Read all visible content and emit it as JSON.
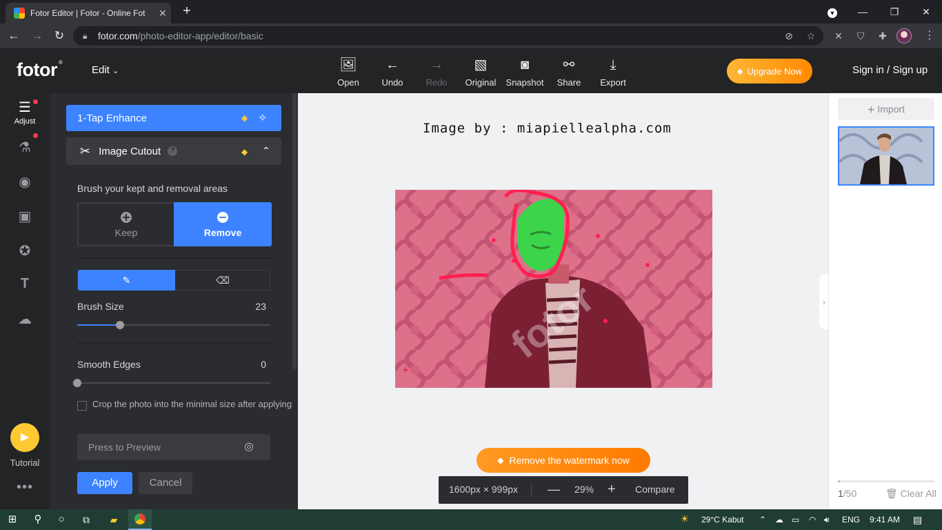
{
  "browser": {
    "tab_title": "Fotor Editor  |  Fotor - Online Fot",
    "url_host": "fotor.com",
    "url_path": "/photo-editor-app/editor/basic"
  },
  "header": {
    "logo": "fotor",
    "edit_menu": "Edit",
    "tools": [
      "Open",
      "Undo",
      "Redo",
      "Original",
      "Snapshot",
      "Share",
      "Export"
    ],
    "upgrade": "Upgrade Now",
    "sign_in": "Sign in / Sign up"
  },
  "rail": {
    "adjust": "Adjust",
    "tutorial": "Tutorial"
  },
  "panel": {
    "enhance": "1-Tap Enhance",
    "cutout": "Image Cutout",
    "brush_hint": "Brush your kept and removal areas",
    "keep": "Keep",
    "remove": "Remove",
    "brush_size_label": "Brush Size",
    "brush_size_value": "23",
    "brush_size_fraction": 0.22,
    "smooth_label": "Smooth Edges",
    "smooth_value": "0",
    "smooth_fraction": 0,
    "crop_label": "Crop the photo into the minimal size after applying",
    "crop_checked": false,
    "preview": "Press to Preview",
    "apply": "Apply",
    "cancel": "Cancel"
  },
  "canvas": {
    "credit": "Image by : miapiellealpha.com",
    "watermark_button": "Remove the watermark now",
    "dimensions": "1600px × 999px",
    "zoom": "29%",
    "compare": "Compare"
  },
  "right": {
    "import": "Import",
    "count_current": "1",
    "count_total": "/50",
    "clear_all": "Clear All"
  },
  "taskbar": {
    "weather": "29°C  Kabut",
    "lang": "ENG",
    "time": "9:41 AM"
  },
  "colors": {
    "accent": "#3d83ff",
    "upgrade": "#ff8a00",
    "cutout_overlay": "#e8446a",
    "kept_mask": "#3bd44a"
  }
}
